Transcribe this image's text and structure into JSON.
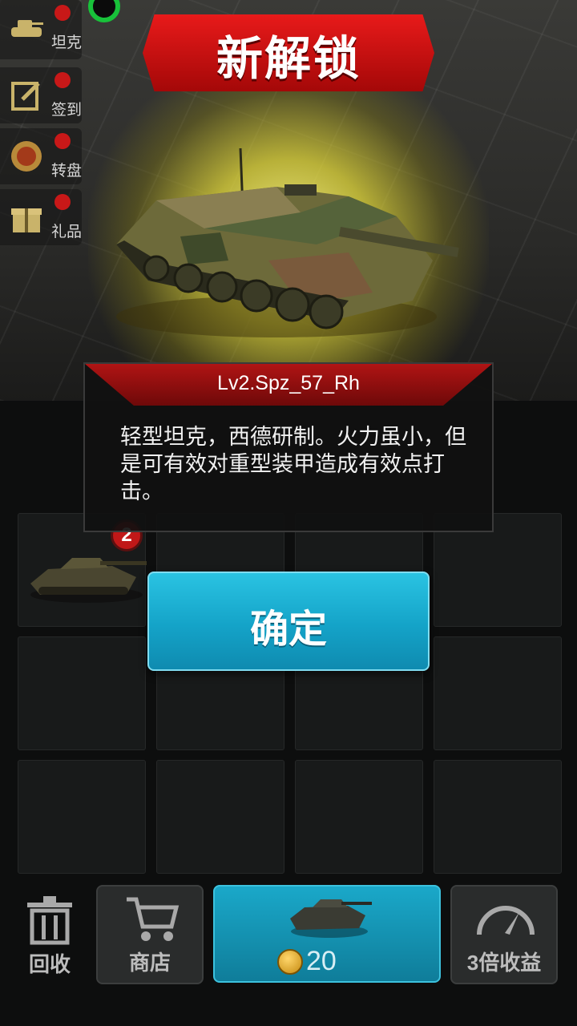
{
  "side_menu": {
    "items": [
      {
        "label": "坦克",
        "icon": "tank-icon"
      },
      {
        "label": "签到",
        "icon": "checkin-icon"
      },
      {
        "label": "转盘",
        "icon": "wheel-icon"
      },
      {
        "label": "礼品",
        "icon": "gift-icon"
      }
    ]
  },
  "popup": {
    "title": "新解锁",
    "tank_name": "Lv2.Spz_57_Rh",
    "description": "轻型坦克，西德研制。火力虽小，但是可有效对重型装甲造成有效点打击。",
    "confirm_label": "确定"
  },
  "grid": {
    "slot_level_badge": "2"
  },
  "bottom_bar": {
    "recycle_label": "回收",
    "shop_label": "商店",
    "buy_price": "20",
    "income_label": "3倍收益"
  },
  "colors": {
    "accent_blue": "#14a3c8",
    "banner_red": "#c81010",
    "glow_yellow": "#e6dc3c"
  }
}
